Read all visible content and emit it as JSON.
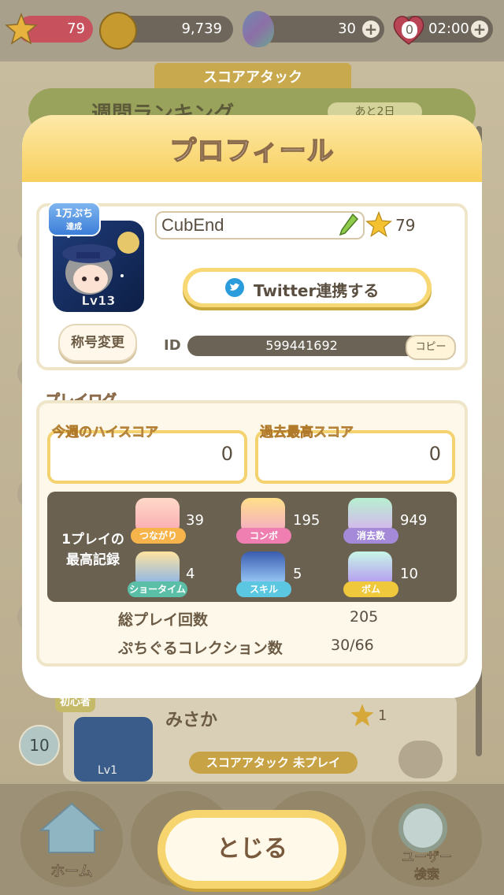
{
  "header": {
    "level": "79",
    "coins": "9,739",
    "gems": "30",
    "hearts": "0",
    "timer": "02:00"
  },
  "background": {
    "banner": "スコアアタック",
    "weekly_title": "週間ランキング",
    "weekly_badge": "あと2日",
    "rank_row": {
      "rank": "10",
      "name": "みさか",
      "stars": "1",
      "badge": "初心者",
      "avatar_level": "Lv1",
      "status": "スコアアタック 未プレイ"
    },
    "nav": {
      "home": "ホーム",
      "user_search_line1": "ユーザー",
      "user_search_line2": "検索"
    }
  },
  "modal": {
    "title": "プロフィール",
    "profile": {
      "avatar_badge_top": "1万ぷち",
      "avatar_badge_bottom": "達成",
      "avatar_level": "Lv13",
      "name": "CubEnd",
      "rank": "79",
      "twitter_label": "Twitter連携する",
      "title_change_label": "称号変更",
      "id_label": "ID",
      "id_value": "599441692",
      "copy_label": "コピー"
    },
    "playlog": {
      "label": "プレイログ",
      "weekly_high_label": "今週のハイスコア",
      "weekly_high_value": "0",
      "alltime_high_label": "過去最高スコア",
      "alltime_high_value": "0",
      "records_label_line1": "1プレイの",
      "records_label_line2": "最高記録",
      "records": [
        {
          "label": "つながり",
          "value": "39"
        },
        {
          "label": "コンボ",
          "value": "195"
        },
        {
          "label": "消去数",
          "value": "949"
        },
        {
          "label": "ショータイム",
          "value": "4"
        },
        {
          "label": "スキル",
          "value": "5"
        },
        {
          "label": "ボム",
          "value": "10"
        }
      ],
      "total_plays_label": "総プレイ回数",
      "total_plays_value": "205",
      "collection_label": "ぷちぐるコレクション数",
      "collection_value": "30/66"
    },
    "close_label": "とじる"
  },
  "colors": {
    "accent": "#f7d875",
    "title_stroke": "#8b6b4a",
    "records_bg": "#6a6151"
  }
}
